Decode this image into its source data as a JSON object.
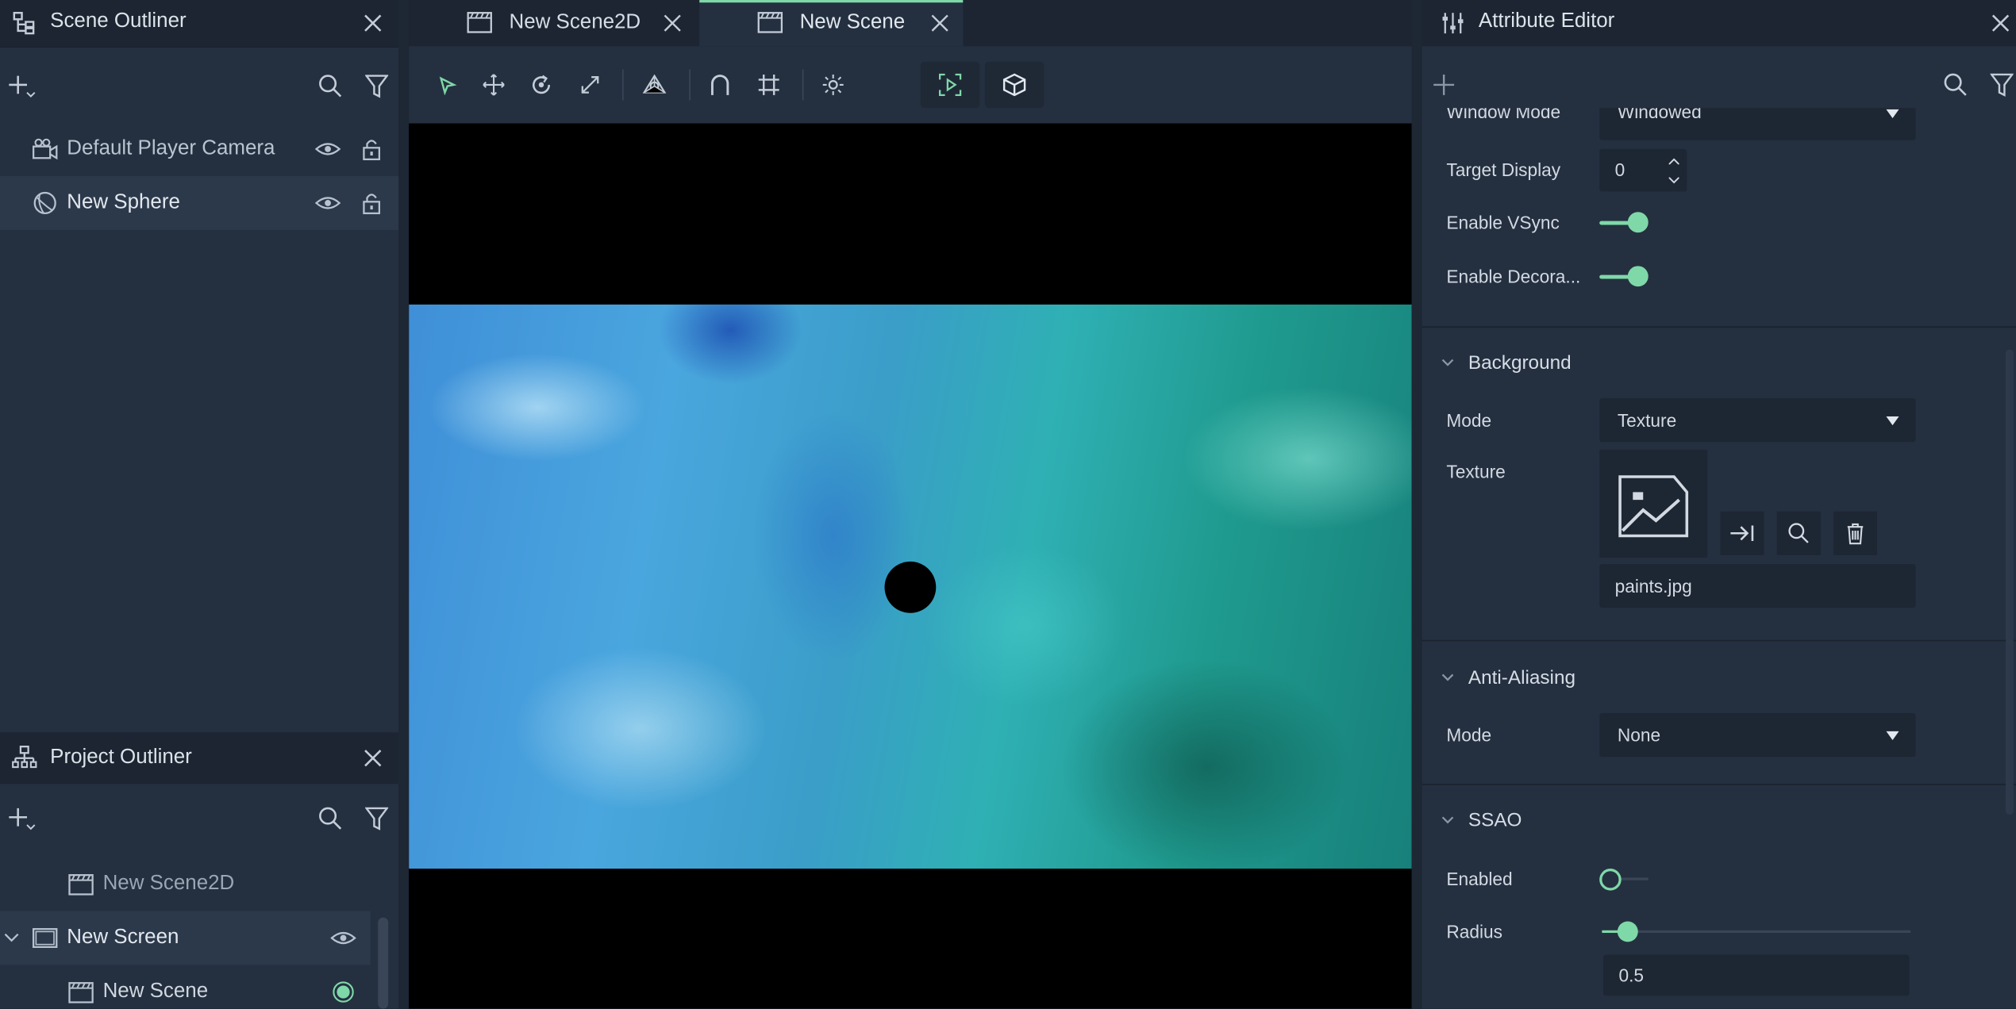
{
  "scene_outliner": {
    "title": "Scene Outliner",
    "items": [
      {
        "label": "Default Player Camera",
        "icon": "camera-icon"
      },
      {
        "label": "New Sphere",
        "icon": "sphere-icon"
      }
    ]
  },
  "project_outliner": {
    "title": "Project Outliner",
    "items": [
      {
        "label": "New Scene2D",
        "icon": "scene-icon"
      },
      {
        "label": "New Screen",
        "icon": "screen-icon"
      },
      {
        "label": "New Scene",
        "icon": "scene-icon"
      }
    ]
  },
  "tabs": [
    {
      "label": "New Scene2D",
      "active": false
    },
    {
      "label": "New Scene",
      "active": true
    }
  ],
  "viewport": {
    "background_texture": "paints.jpg"
  },
  "attribute_editor": {
    "title": "Attribute Editor",
    "window_mode": {
      "label": "Window Mode",
      "value": "Windowed"
    },
    "target_display": {
      "label": "Target Display",
      "value": "0"
    },
    "enable_vsync": {
      "label": "Enable VSync",
      "on": true
    },
    "enable_decorations": {
      "label": "Enable Decora...",
      "on": true
    },
    "background": {
      "title": "Background",
      "mode_label": "Mode",
      "mode_value": "Texture",
      "texture_label": "Texture",
      "texture_file": "paints.jpg"
    },
    "anti_aliasing": {
      "title": "Anti-Aliasing",
      "mode_label": "Mode",
      "mode_value": "None"
    },
    "ssao": {
      "title": "SSAO",
      "enabled_label": "Enabled",
      "enabled": false,
      "radius_label": "Radius",
      "radius_value": "0.5"
    }
  },
  "colors": {
    "accent": "#7fd8a8",
    "panel": "#243040",
    "header": "#1c2531",
    "viewport_bg": "#000000"
  }
}
